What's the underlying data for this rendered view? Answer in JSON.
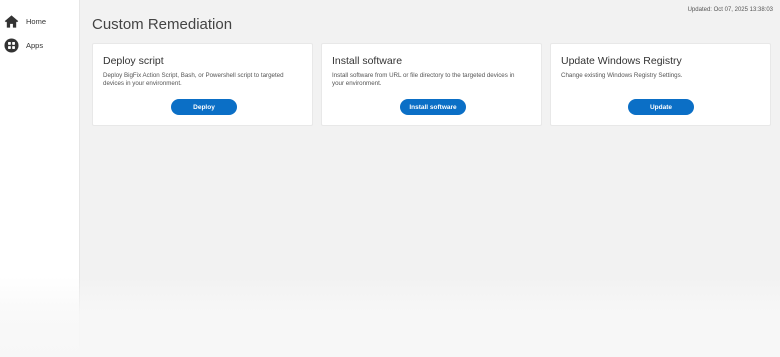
{
  "sidebar": {
    "items": [
      {
        "label": "Home",
        "icon": "home-icon"
      },
      {
        "label": "Apps",
        "icon": "apps-icon"
      }
    ]
  },
  "header": {
    "updated": "Updated: Oct 07, 2025 13:38:03",
    "title": "Custom Remediation"
  },
  "cards": [
    {
      "title": "Deploy script",
      "description": "Deploy BigFix Action Script, Bash, or Powershell script to targeted devices in your environment.",
      "button": "Deploy"
    },
    {
      "title": "Install software",
      "description": "Install software from URL or file directory to the targeted devices in your environment.",
      "button": "Install software"
    },
    {
      "title": "Update Windows Registry",
      "description": "Change existing Windows Registry Settings.",
      "button": "Update"
    }
  ],
  "colors": {
    "accent": "#0b6fc6",
    "background": "#f2f2f2",
    "card": "#ffffff"
  }
}
